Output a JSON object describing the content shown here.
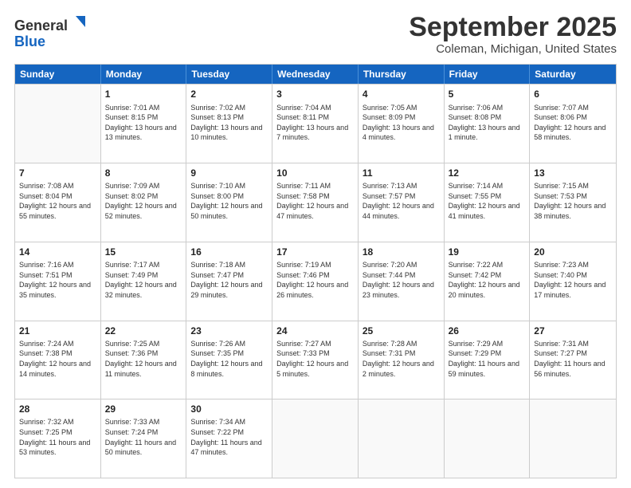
{
  "logo": {
    "general": "General",
    "blue": "Blue"
  },
  "header": {
    "month": "September 2025",
    "location": "Coleman, Michigan, United States"
  },
  "days_of_week": [
    "Sunday",
    "Monday",
    "Tuesday",
    "Wednesday",
    "Thursday",
    "Friday",
    "Saturday"
  ],
  "weeks": [
    [
      {
        "day": "",
        "sunrise": "",
        "sunset": "",
        "daylight": ""
      },
      {
        "day": "1",
        "sunrise": "Sunrise: 7:01 AM",
        "sunset": "Sunset: 8:15 PM",
        "daylight": "Daylight: 13 hours and 13 minutes."
      },
      {
        "day": "2",
        "sunrise": "Sunrise: 7:02 AM",
        "sunset": "Sunset: 8:13 PM",
        "daylight": "Daylight: 13 hours and 10 minutes."
      },
      {
        "day": "3",
        "sunrise": "Sunrise: 7:04 AM",
        "sunset": "Sunset: 8:11 PM",
        "daylight": "Daylight: 13 hours and 7 minutes."
      },
      {
        "day": "4",
        "sunrise": "Sunrise: 7:05 AM",
        "sunset": "Sunset: 8:09 PM",
        "daylight": "Daylight: 13 hours and 4 minutes."
      },
      {
        "day": "5",
        "sunrise": "Sunrise: 7:06 AM",
        "sunset": "Sunset: 8:08 PM",
        "daylight": "Daylight: 13 hours and 1 minute."
      },
      {
        "day": "6",
        "sunrise": "Sunrise: 7:07 AM",
        "sunset": "Sunset: 8:06 PM",
        "daylight": "Daylight: 12 hours and 58 minutes."
      }
    ],
    [
      {
        "day": "7",
        "sunrise": "Sunrise: 7:08 AM",
        "sunset": "Sunset: 8:04 PM",
        "daylight": "Daylight: 12 hours and 55 minutes."
      },
      {
        "day": "8",
        "sunrise": "Sunrise: 7:09 AM",
        "sunset": "Sunset: 8:02 PM",
        "daylight": "Daylight: 12 hours and 52 minutes."
      },
      {
        "day": "9",
        "sunrise": "Sunrise: 7:10 AM",
        "sunset": "Sunset: 8:00 PM",
        "daylight": "Daylight: 12 hours and 50 minutes."
      },
      {
        "day": "10",
        "sunrise": "Sunrise: 7:11 AM",
        "sunset": "Sunset: 7:58 PM",
        "daylight": "Daylight: 12 hours and 47 minutes."
      },
      {
        "day": "11",
        "sunrise": "Sunrise: 7:13 AM",
        "sunset": "Sunset: 7:57 PM",
        "daylight": "Daylight: 12 hours and 44 minutes."
      },
      {
        "day": "12",
        "sunrise": "Sunrise: 7:14 AM",
        "sunset": "Sunset: 7:55 PM",
        "daylight": "Daylight: 12 hours and 41 minutes."
      },
      {
        "day": "13",
        "sunrise": "Sunrise: 7:15 AM",
        "sunset": "Sunset: 7:53 PM",
        "daylight": "Daylight: 12 hours and 38 minutes."
      }
    ],
    [
      {
        "day": "14",
        "sunrise": "Sunrise: 7:16 AM",
        "sunset": "Sunset: 7:51 PM",
        "daylight": "Daylight: 12 hours and 35 minutes."
      },
      {
        "day": "15",
        "sunrise": "Sunrise: 7:17 AM",
        "sunset": "Sunset: 7:49 PM",
        "daylight": "Daylight: 12 hours and 32 minutes."
      },
      {
        "day": "16",
        "sunrise": "Sunrise: 7:18 AM",
        "sunset": "Sunset: 7:47 PM",
        "daylight": "Daylight: 12 hours and 29 minutes."
      },
      {
        "day": "17",
        "sunrise": "Sunrise: 7:19 AM",
        "sunset": "Sunset: 7:46 PM",
        "daylight": "Daylight: 12 hours and 26 minutes."
      },
      {
        "day": "18",
        "sunrise": "Sunrise: 7:20 AM",
        "sunset": "Sunset: 7:44 PM",
        "daylight": "Daylight: 12 hours and 23 minutes."
      },
      {
        "day": "19",
        "sunrise": "Sunrise: 7:22 AM",
        "sunset": "Sunset: 7:42 PM",
        "daylight": "Daylight: 12 hours and 20 minutes."
      },
      {
        "day": "20",
        "sunrise": "Sunrise: 7:23 AM",
        "sunset": "Sunset: 7:40 PM",
        "daylight": "Daylight: 12 hours and 17 minutes."
      }
    ],
    [
      {
        "day": "21",
        "sunrise": "Sunrise: 7:24 AM",
        "sunset": "Sunset: 7:38 PM",
        "daylight": "Daylight: 12 hours and 14 minutes."
      },
      {
        "day": "22",
        "sunrise": "Sunrise: 7:25 AM",
        "sunset": "Sunset: 7:36 PM",
        "daylight": "Daylight: 12 hours and 11 minutes."
      },
      {
        "day": "23",
        "sunrise": "Sunrise: 7:26 AM",
        "sunset": "Sunset: 7:35 PM",
        "daylight": "Daylight: 12 hours and 8 minutes."
      },
      {
        "day": "24",
        "sunrise": "Sunrise: 7:27 AM",
        "sunset": "Sunset: 7:33 PM",
        "daylight": "Daylight: 12 hours and 5 minutes."
      },
      {
        "day": "25",
        "sunrise": "Sunrise: 7:28 AM",
        "sunset": "Sunset: 7:31 PM",
        "daylight": "Daylight: 12 hours and 2 minutes."
      },
      {
        "day": "26",
        "sunrise": "Sunrise: 7:29 AM",
        "sunset": "Sunset: 7:29 PM",
        "daylight": "Daylight: 11 hours and 59 minutes."
      },
      {
        "day": "27",
        "sunrise": "Sunrise: 7:31 AM",
        "sunset": "Sunset: 7:27 PM",
        "daylight": "Daylight: 11 hours and 56 minutes."
      }
    ],
    [
      {
        "day": "28",
        "sunrise": "Sunrise: 7:32 AM",
        "sunset": "Sunset: 7:25 PM",
        "daylight": "Daylight: 11 hours and 53 minutes."
      },
      {
        "day": "29",
        "sunrise": "Sunrise: 7:33 AM",
        "sunset": "Sunset: 7:24 PM",
        "daylight": "Daylight: 11 hours and 50 minutes."
      },
      {
        "day": "30",
        "sunrise": "Sunrise: 7:34 AM",
        "sunset": "Sunset: 7:22 PM",
        "daylight": "Daylight: 11 hours and 47 minutes."
      },
      {
        "day": "",
        "sunrise": "",
        "sunset": "",
        "daylight": ""
      },
      {
        "day": "",
        "sunrise": "",
        "sunset": "",
        "daylight": ""
      },
      {
        "day": "",
        "sunrise": "",
        "sunset": "",
        "daylight": ""
      },
      {
        "day": "",
        "sunrise": "",
        "sunset": "",
        "daylight": ""
      }
    ]
  ]
}
